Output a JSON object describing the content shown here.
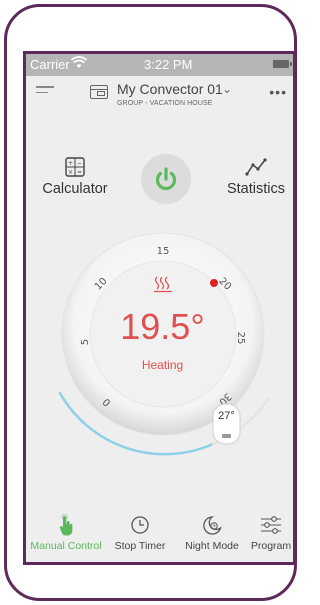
{
  "status_bar": {
    "carrier": "Carrier",
    "time": "3:22 PM"
  },
  "header": {
    "device_name": "My Convector 01",
    "device_group": "GROUP - VACATION HOUSE"
  },
  "tools": {
    "calculator_label": "Calculator",
    "statistics_label": "Statistics"
  },
  "dial": {
    "ticks": [
      "5",
      "10",
      "15",
      "20",
      "25",
      "30",
      "0"
    ],
    "current_temp": "19.5°",
    "mode": "Heating",
    "setpoint": "27°"
  },
  "tabs": [
    {
      "label": "Manual Control",
      "icon": "hand-pointer-icon",
      "active": true
    },
    {
      "label": "Stop Timer",
      "icon": "clock-icon",
      "active": false
    },
    {
      "label": "Night Mode",
      "icon": "moon-clock-icon",
      "active": false
    },
    {
      "label": "Program",
      "icon": "sliders-icon",
      "active": false
    }
  ],
  "colors": {
    "accent_green": "#5cb85c",
    "temp_red": "#e05050",
    "arc_blue": "#7ec8e3",
    "frame_purple": "#5e2a5c"
  }
}
